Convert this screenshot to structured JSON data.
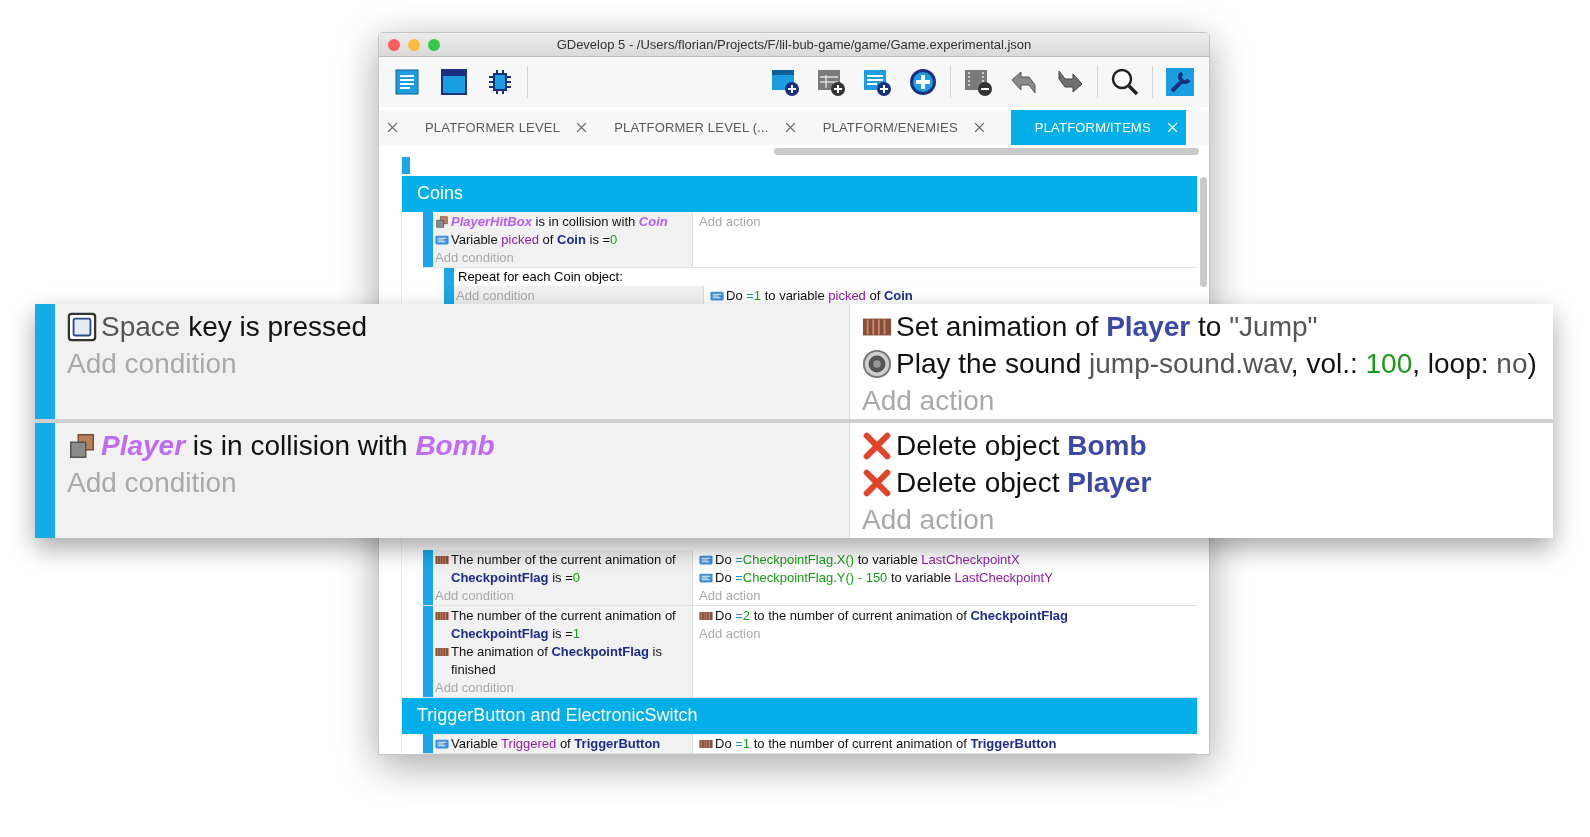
{
  "window": {
    "title": "GDevelop 5 - /Users/florian/Projects/F/lil-bub-game/game/Game.experimental.json"
  },
  "tabs": [
    {
      "label": "PLATFORMER LEVEL",
      "selected": false
    },
    {
      "label": "PLATFORMER LEVEL (...",
      "selected": false
    },
    {
      "label": "PLATFORM/ENEMIES",
      "selected": false
    },
    {
      "label": "PLATFORM/ITEMS",
      "selected": true
    }
  ],
  "events_top": {
    "group_title": "Coins",
    "event": {
      "conditions": [
        {
          "kind": "collision",
          "parts": [
            {
              "text": "PlayerHitBox",
              "kind": "object-italic"
            },
            {
              "text": " is in collision with ",
              "kind": "plain"
            },
            {
              "text": "Coin",
              "kind": "object-italic"
            }
          ]
        },
        {
          "kind": "variable",
          "parts": [
            {
              "text": "Variable ",
              "kind": "plain"
            },
            {
              "text": "picked",
              "kind": "variable"
            },
            {
              "text": " of ",
              "kind": "plain"
            },
            {
              "text": "Coin",
              "kind": "object"
            },
            {
              "text": " is =",
              "kind": "plain"
            },
            {
              "text": "0",
              "kind": "number"
            }
          ]
        }
      ],
      "add_condition": "Add condition",
      "add_action": "Add action"
    },
    "sub_event": {
      "title": "Repeat for each Coin object:",
      "add_condition": "Add condition",
      "actions": [
        {
          "kind": "variable",
          "parts": [
            {
              "text": "Do ",
              "kind": "plain"
            },
            {
              "text": "=",
              "kind": "operator"
            },
            {
              "text": "1",
              "kind": "number"
            },
            {
              "text": " to variable ",
              "kind": "plain"
            },
            {
              "text": "picked",
              "kind": "variable"
            },
            {
              "text": " of ",
              "kind": "plain"
            },
            {
              "text": "Coin",
              "kind": "object"
            }
          ]
        }
      ]
    }
  },
  "events_bottom": {
    "events": [
      {
        "conditions": [
          {
            "kind": "animation",
            "parts": [
              {
                "text": "The number of the current animation of ",
                "kind": "plain"
              },
              {
                "text": "CheckpointFlag",
                "kind": "object"
              },
              {
                "text": " is =",
                "kind": "plain"
              },
              {
                "text": "0",
                "kind": "number"
              }
            ]
          }
        ],
        "add_condition": "Add condition",
        "actions": [
          {
            "kind": "variable",
            "parts": [
              {
                "text": "Do ",
                "kind": "plain"
              },
              {
                "text": "=",
                "kind": "operator"
              },
              {
                "text": "CheckpointFlag.X()",
                "kind": "number"
              },
              {
                "text": " to variable ",
                "kind": "plain"
              },
              {
                "text": "LastCheckpointX",
                "kind": "variable"
              }
            ]
          },
          {
            "kind": "variable",
            "parts": [
              {
                "text": "Do ",
                "kind": "plain"
              },
              {
                "text": "=",
                "kind": "operator"
              },
              {
                "text": "CheckpointFlag.Y() - 150",
                "kind": "number"
              },
              {
                "text": " to variable ",
                "kind": "plain"
              },
              {
                "text": "LastCheckpointY",
                "kind": "variable"
              }
            ]
          }
        ],
        "add_action": "Add action"
      },
      {
        "conditions": [
          {
            "kind": "animation",
            "parts": [
              {
                "text": "The number of the current animation of ",
                "kind": "plain"
              },
              {
                "text": "CheckpointFlag",
                "kind": "object"
              },
              {
                "text": " is =",
                "kind": "plain"
              },
              {
                "text": "1",
                "kind": "number"
              }
            ]
          },
          {
            "kind": "animation",
            "parts": [
              {
                "text": "The animation of ",
                "kind": "plain"
              },
              {
                "text": "CheckpointFlag",
                "kind": "object"
              },
              {
                "text": " is finished",
                "kind": "plain"
              }
            ]
          }
        ],
        "add_condition": "Add condition",
        "actions": [
          {
            "kind": "animation",
            "parts": [
              {
                "text": "Do ",
                "kind": "plain"
              },
              {
                "text": "=",
                "kind": "operator"
              },
              {
                "text": "2",
                "kind": "number"
              },
              {
                "text": " to the number of current animation of ",
                "kind": "plain"
              },
              {
                "text": "CheckpointFlag",
                "kind": "object"
              }
            ]
          }
        ],
        "add_action": "Add action"
      }
    ],
    "group_title": "TriggerButton and ElectronicSwitch",
    "event": {
      "conditions": [
        {
          "kind": "variable",
          "parts": [
            {
              "text": "Variable ",
              "kind": "plain"
            },
            {
              "text": "Triggered",
              "kind": "variable"
            },
            {
              "text": " of ",
              "kind": "plain"
            },
            {
              "text": "TriggerButton",
              "kind": "object"
            }
          ]
        }
      ],
      "actions": [
        {
          "kind": "animation",
          "parts": [
            {
              "text": "Do ",
              "kind": "plain"
            },
            {
              "text": "=",
              "kind": "operator"
            },
            {
              "text": "1",
              "kind": "number"
            },
            {
              "text": " to the number of current animation of ",
              "kind": "plain"
            },
            {
              "text": "TriggerButton",
              "kind": "object"
            }
          ]
        }
      ]
    }
  },
  "overlay": {
    "events": [
      {
        "conditions": [
          {
            "kind": "keyboard",
            "parts": [
              {
                "text": "Space",
                "kind": "value"
              },
              {
                "text": " key is pressed",
                "kind": "plain"
              }
            ]
          }
        ],
        "add_condition": "Add condition",
        "actions": [
          {
            "kind": "animation",
            "parts": [
              {
                "text": "Set animation of ",
                "kind": "plain"
              },
              {
                "text": "Player",
                "kind": "object"
              },
              {
                "text": " to ",
                "kind": "plain"
              },
              {
                "text": "\"Jump\"",
                "kind": "value"
              }
            ]
          },
          {
            "kind": "sound",
            "parts": [
              {
                "text": "Play the sound ",
                "kind": "plain"
              },
              {
                "text": "jump-sound.wav",
                "kind": "value"
              },
              {
                "text": ", vol.: ",
                "kind": "plain"
              },
              {
                "text": "100",
                "kind": "number"
              },
              {
                "text": ", loop: ",
                "kind": "plain"
              },
              {
                "text": "no",
                "kind": "value"
              },
              {
                "text": ")",
                "kind": "plain"
              }
            ]
          }
        ],
        "add_action": "Add action"
      },
      {
        "conditions": [
          {
            "kind": "collision",
            "parts": [
              {
                "text": "Player",
                "kind": "object-italic"
              },
              {
                "text": " is in collision with ",
                "kind": "plain"
              },
              {
                "text": "Bomb",
                "kind": "object-italic"
              }
            ]
          }
        ],
        "add_condition": "Add condition",
        "actions": [
          {
            "kind": "delete",
            "parts": [
              {
                "text": "Delete object ",
                "kind": "plain"
              },
              {
                "text": "Bomb",
                "kind": "object"
              }
            ]
          },
          {
            "kind": "delete",
            "parts": [
              {
                "text": "Delete object ",
                "kind": "plain"
              },
              {
                "text": "Player",
                "kind": "object"
              }
            ]
          }
        ],
        "add_action": "Add action"
      }
    ]
  }
}
